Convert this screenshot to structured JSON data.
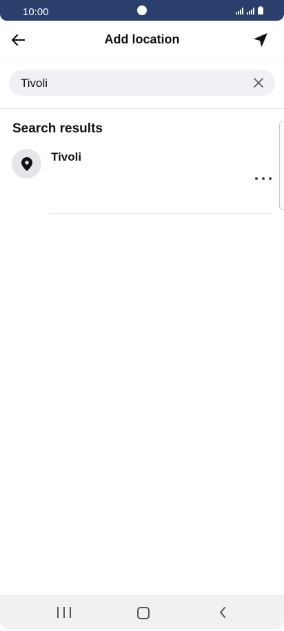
{
  "status_bar": {
    "time": "10:00"
  },
  "header": {
    "title": "Add location"
  },
  "search": {
    "value": "Tivoli"
  },
  "results": {
    "heading": "Search results",
    "items": [
      {
        "name": "Tivoli"
      }
    ]
  },
  "icons": {
    "back": "arrow-left-icon",
    "navigate": "navigation-arrow-icon",
    "clear": "close-icon",
    "location": "map-pin-icon",
    "more": "more-horizontal-icon"
  },
  "colors": {
    "status_bar_bg": "#2b3f6c",
    "search_bg": "#eff1f5",
    "avatar_bg": "#e4e6ea"
  }
}
